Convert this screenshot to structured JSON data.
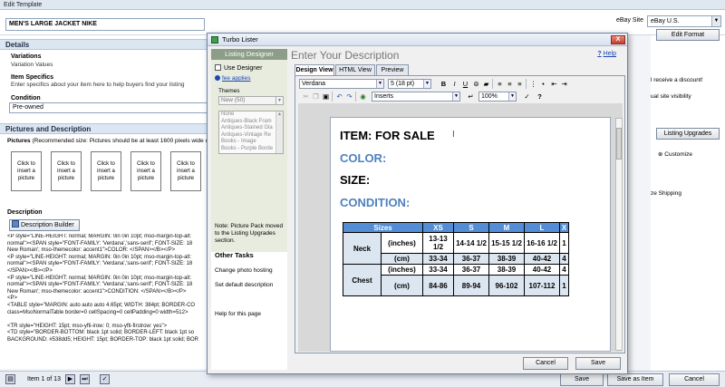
{
  "window": {
    "title": "Edit Template"
  },
  "listing": {
    "title": "MEN'S LARGE JACKET NIKE"
  },
  "ebay_site": {
    "label": "eBay Site",
    "value": "eBay U.S."
  },
  "details": {
    "section_title": "Details",
    "variations_label": "Variations",
    "variations_value": "Variation Values",
    "item_specifics_label": "Item Specifics",
    "item_specifics_help": "Enter specifics about your item here to help buyers find your listing",
    "condition_label": "Condition",
    "condition_value": "Pre-owned"
  },
  "pictures": {
    "section_title": "Pictures and Description",
    "label": "Pictures",
    "note": "(Recommended size: Pictures should be at least 1600 pixels wide or",
    "box_label": "Click to insert a picture"
  },
  "description": {
    "label": "Description",
    "builder_button": "Description Builder",
    "code_lines": [
      "<P style=\"LINE-HEIGHT: normal; MARGIN: 0in 0in 10pt; mso-margin-top-alt:",
      "normal\"><SPAN style=\"FONT-FAMILY: 'Verdana','sans-serif'; FONT-SIZE: 18",
      "New Roman'; mso-themecolor: accent1\">COLOR: </SPAN></B></P>",
      "<P style=\"LINE-HEIGHT: normal; MARGIN: 0in 0in 10pt; mso-margin-top-alt:",
      "normal\"><SPAN style=\"FONT-FAMILY: 'Verdana','sans-serif'; FONT-SIZE: 18",
      "</SPAN></B></P>",
      "<P style=\"LINE-HEIGHT: normal; MARGIN: 0in 0in 10pt; mso-margin-top-alt:",
      "normal\"><SPAN style=\"FONT-FAMILY: 'Verdana','sans-serif'; FONT-SIZE: 18",
      "New Roman'; mso-themecolor: accent1\">CONDITION: </SPAN></B></P>",
      "<P>",
      "<TABLE style=\"MARGIN: auto auto auto 4.65pt; WIDTH: 384pt; BORDER-CO",
      "class=MsoNormalTable border=0 cellSpacing=0 cellPadding=0 width=512>",
      "",
      "<TR style=\"HEIGHT: 15pt; mso-yfti-irow: 0; mso-yfti-firstrow: yes\">",
      "<TD style=\"BORDER-BOTTOM: black 1pt solid; BORDER-LEFT: black 1pt so",
      "BACKGROUND: #538dd5; HEIGHT: 15pt; BORDER-TOP: black 1pt solid; BOR"
    ]
  },
  "status_bar": {
    "item_of": "Item 1 of 13",
    "save": "Save",
    "save_as_item": "Save as Item",
    "cancel": "Cancel"
  },
  "right_panel": {
    "edit_format": "Edit Format",
    "discount_text": "l receive a discount!",
    "visibility_text": "ual site visibility",
    "listing_upgrades": "Listing Upgrades",
    "customize": "Customize",
    "shipping_text": "ze Shipping"
  },
  "dialog": {
    "title": "Turbo Lister",
    "close_label": "X",
    "sidebar": {
      "header": "Listing Designer",
      "use_designer": "Use Designer",
      "fee_link": "fee applies",
      "themes_label": "Themes",
      "themes_selected": "New (50)",
      "themes_list": [
        "None",
        "Antiques-Black Fram",
        "Antiques-Stained Gla",
        "Antiques-Vintage Re",
        "Books - Image",
        "Books - Purple Borde"
      ],
      "note": "Note: Picture Pack moved to the Listing Upgrades section.",
      "other_tasks": "Other Tasks",
      "tasks": [
        "Change photo hosting",
        "Set default description",
        "Help for this page"
      ]
    },
    "main": {
      "heading": "Enter Your Description",
      "help": "Help",
      "tabs": [
        "Design View",
        "HTML View",
        "Preview"
      ],
      "toolbar": {
        "font": "Verdana",
        "size": "5 (18 pt)",
        "inserts": "Inserts",
        "zoom": "100%"
      },
      "doc": {
        "item_line": "ITEM: FOR SALE",
        "color_line": "COLOR:",
        "size_line": "SIZE:",
        "condition_line": "CONDITION:"
      },
      "table": {
        "header": [
          "Sizes",
          "",
          "XS",
          "S",
          "M",
          "L",
          "X"
        ],
        "rows": [
          [
            "Neck",
            "(inches)",
            "13-13 1/2",
            "14-14 1/2",
            "15-15 1/2",
            "16-16 1/2",
            "1"
          ],
          [
            "",
            "(cm)",
            "33-34",
            "36-37",
            "38-39",
            "40-42",
            "4"
          ],
          [
            "Chest",
            "(inches)",
            "33-34",
            "36-37",
            "38-39",
            "40-42",
            "4"
          ],
          [
            "",
            "(cm)",
            "84-86",
            "89-94",
            "96-102",
            "107-112",
            "1"
          ]
        ]
      }
    },
    "cancel": "Cancel",
    "save": "Save"
  }
}
